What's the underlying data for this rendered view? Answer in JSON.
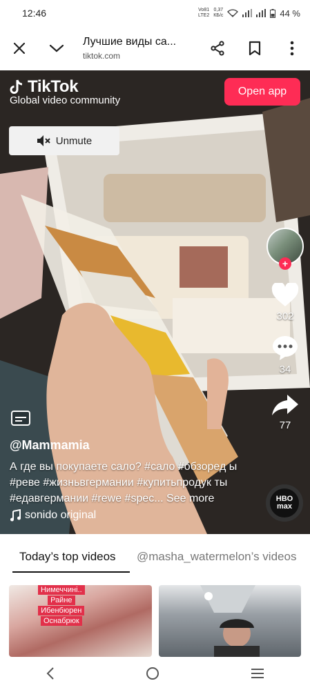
{
  "status": {
    "time": "12:46",
    "network_top": "Vo81",
    "network_bottom": "LTE2",
    "speed_top": "0,37",
    "speed_bottom": "КБ/с",
    "battery": "44 %"
  },
  "browser": {
    "title": "Лучшие виды са...",
    "url": "tiktok.com",
    "icons": [
      "close-icon",
      "chevron-down-icon",
      "share-icon",
      "bookmark-icon",
      "more-vertical-icon"
    ]
  },
  "video": {
    "brand": "TikTok",
    "brand_subtitle": "Global video community",
    "open_app_label": "Open app",
    "unmute_label": "Unmute",
    "author": "@Mammamia",
    "description": "А где вы покупаете сало? #сало #обзоред ы #реве #жизньвгермании #купитьпродук ты #едавгермании #rewe #spec...",
    "see_more": "See more",
    "sound": "sonido original",
    "likes": "302",
    "comments": "34",
    "shares": "77",
    "disc_text": "HBO max",
    "accent_color": "#fe2c55"
  },
  "tabs": [
    {
      "label": "Today’s top videos",
      "active": true
    },
    {
      "label": "@masha_watermelon’s videos",
      "active": false
    }
  ],
  "thumbnails": [
    {
      "tags": [
        "Нимеччині..",
        "Райне",
        "Ибенбюрен",
        "Оснабрюк"
      ]
    },
    {
      "tags": []
    }
  ],
  "navbar": {
    "icons": [
      "back-icon",
      "home-icon",
      "recent-apps-icon"
    ]
  }
}
